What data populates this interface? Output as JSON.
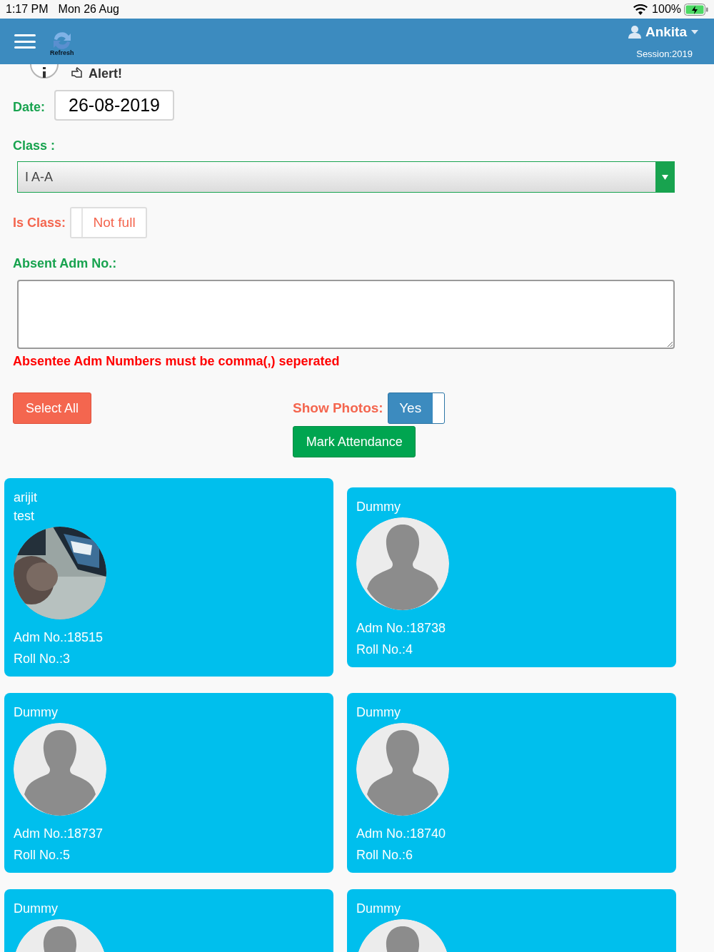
{
  "status_bar": {
    "time": "1:17 PM",
    "date": "Mon 26 Aug",
    "battery": "100%"
  },
  "header": {
    "refresh_label": "Refresh",
    "user": "Ankita",
    "session": "Session:2019"
  },
  "alert": {
    "label": "Alert!"
  },
  "form": {
    "date_label": "Date:",
    "date_value": "26-08-2019",
    "class_label": "Class :",
    "class_value": "I A-A",
    "is_class_label": "Is Class:",
    "is_class_toggle": {
      "label": "Not full",
      "on": false
    },
    "absent_label": "Absent Adm No.:",
    "hint": "Absentee Adm Numbers must be comma(,) seperated"
  },
  "actions": {
    "select_all": "Select All",
    "show_photos_label": "Show Photos:",
    "show_photos_toggle": {
      "label": "Yes",
      "on": true
    },
    "mark_attendance": "Mark Attendance"
  },
  "students": [
    {
      "names": [
        "arijit",
        "test"
      ],
      "adm": "Adm No.:18515",
      "roll": "Roll No.:3"
    },
    {
      "names": [
        "Dummy"
      ],
      "kind": "silhouette",
      "adm": "Adm No.:18738",
      "roll": "Roll No.:4"
    },
    {
      "names": [
        "Dummy"
      ],
      "kind": "silhouette",
      "adm": "Adm No.:18737",
      "roll": "Roll No.:5"
    },
    {
      "names": [
        "Dummy"
      ],
      "kind": "silhouette",
      "adm": "Adm No.:18740",
      "roll": "Roll No.:6"
    },
    {
      "names": [
        "Dummy"
      ],
      "kind": "silhouette"
    },
    {
      "names": [
        "Dummy"
      ],
      "kind": "silhouette"
    }
  ]
}
